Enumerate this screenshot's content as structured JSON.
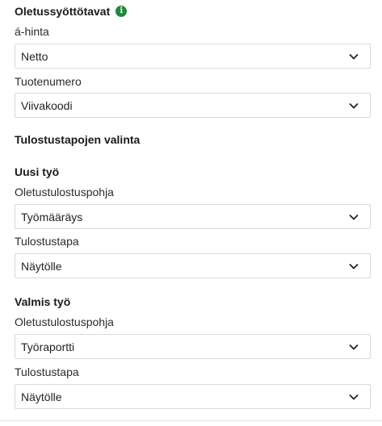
{
  "defaults": {
    "heading": "Oletussyöttötavat",
    "info_icon": "i",
    "unit_price": {
      "label": "á-hinta",
      "value": "Netto"
    },
    "product_number": {
      "label": "Tuotenumero",
      "value": "Viivakoodi"
    }
  },
  "print_methods": {
    "heading": "Tulostustapojen valinta",
    "new_job": {
      "heading": "Uusi työ",
      "template": {
        "label": "Oletustulostuspohja",
        "value": "Työmääräys"
      },
      "method": {
        "label": "Tulostustapa",
        "value": "Näytölle"
      }
    },
    "finished_job": {
      "heading": "Valmis työ",
      "template": {
        "label": "Oletustulostuspohja",
        "value": "Työraportti"
      },
      "method": {
        "label": "Tulostustapa",
        "value": "Näytölle"
      }
    }
  },
  "colors": {
    "info_icon": "#1f8a3a",
    "border": "#d9d9d9"
  }
}
